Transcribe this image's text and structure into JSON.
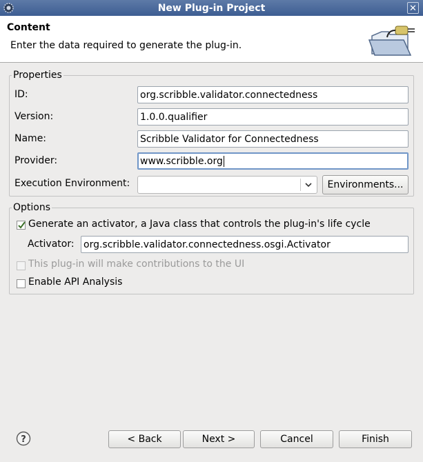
{
  "window": {
    "title": "New Plug-in Project",
    "close_glyph": "✕"
  },
  "header": {
    "title": "Content",
    "description": "Enter the data required to generate the plug-in.",
    "banner_icon": "plugin-folder-icon"
  },
  "properties": {
    "legend": "Properties",
    "id_label": "ID:",
    "id_value": "org.scribble.validator.connectedness",
    "version_label": "Version:",
    "version_value": "1.0.0.qualifier",
    "name_label": "Name:",
    "name_value": "Scribble Validator for Connectedness",
    "provider_label": "Provider:",
    "provider_value": "www.scribble.org",
    "exec_env_label": "Execution Environment:",
    "exec_env_value": "",
    "environments_button": "Environments..."
  },
  "options": {
    "legend": "Options",
    "generate_activator_label": "Generate an activator, a Java class that controls the plug-in's life cycle",
    "generate_activator_checked": true,
    "activator_label": "Activator:",
    "activator_value": "org.scribble.validator.connectedness.osgi.Activator",
    "ui_contrib_label": "This plug-in will make contributions to the UI",
    "ui_contrib_checked": false,
    "ui_contrib_enabled": false,
    "api_analysis_label": "Enable API Analysis",
    "api_analysis_checked": false
  },
  "footer": {
    "help_glyph": "?",
    "back_button": "< Back",
    "next_button": "Next >",
    "cancel_button": "Cancel",
    "finish_button": "Finish"
  },
  "colors": {
    "titlebar": "#4a6a9c",
    "focus": "#6f95c7",
    "dialog_bg": "#edeceb"
  }
}
